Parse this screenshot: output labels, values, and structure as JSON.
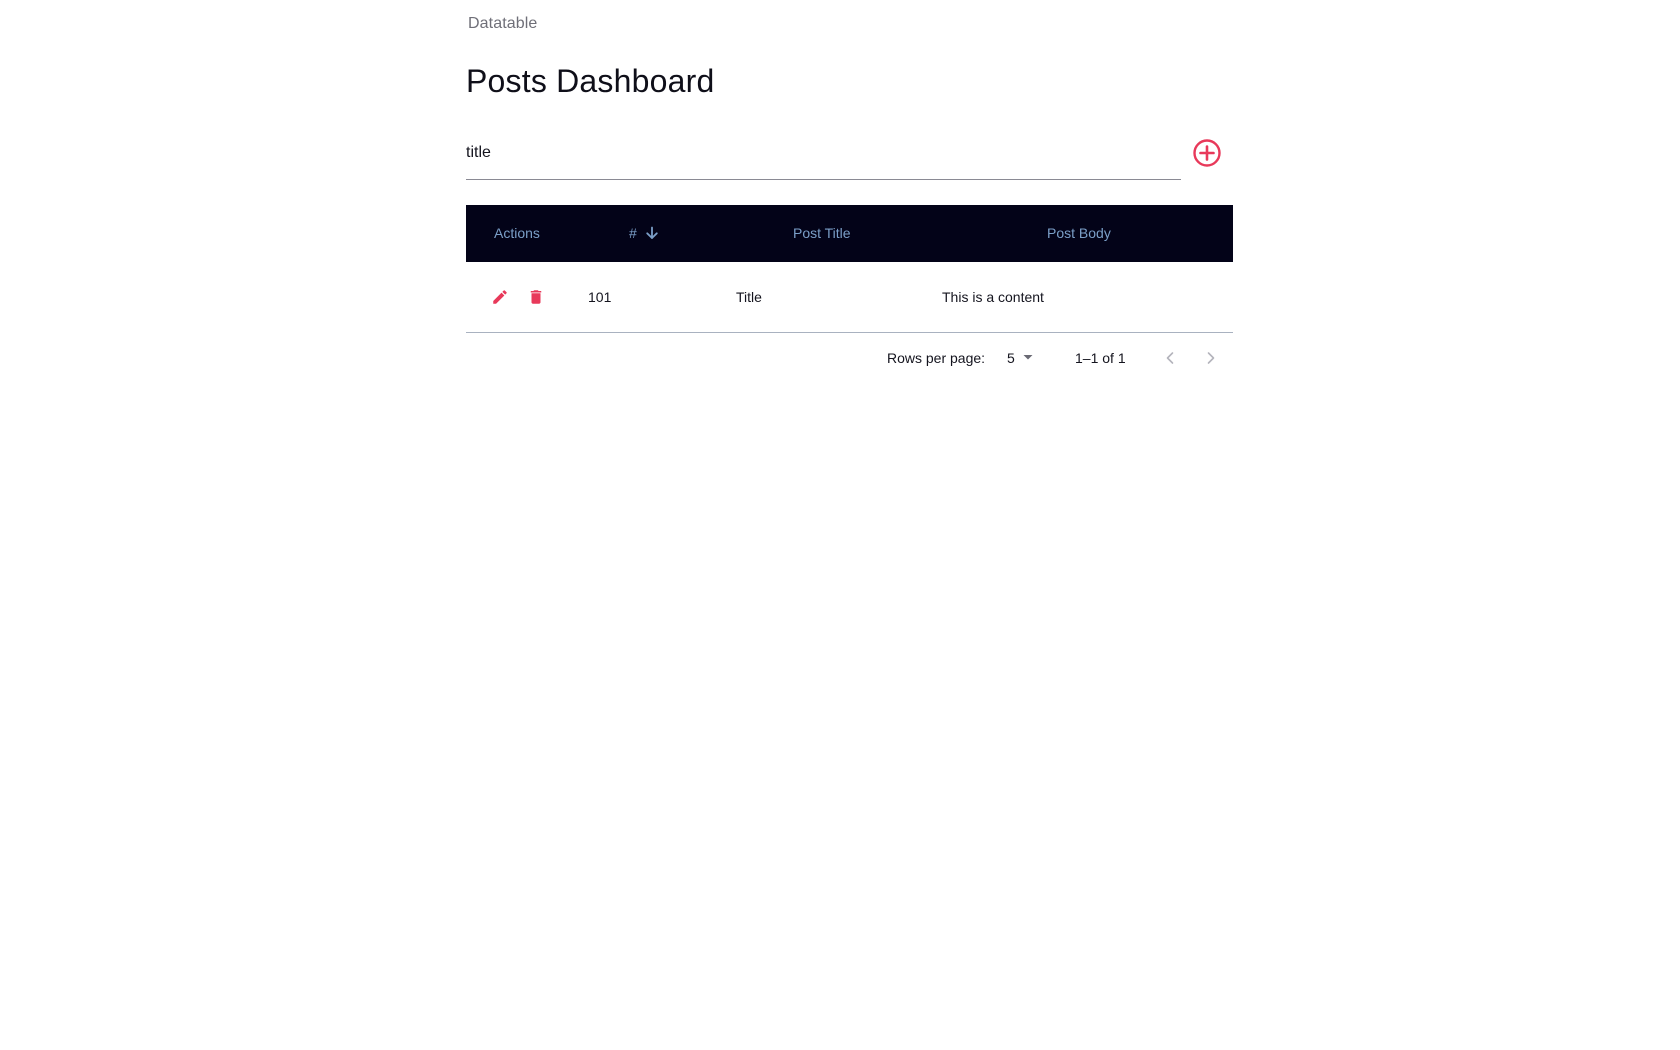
{
  "app": {
    "title": "Datatable"
  },
  "page": {
    "title": "Posts Dashboard"
  },
  "search": {
    "value": "title",
    "placeholder": ""
  },
  "table": {
    "columns": [
      {
        "label": "Actions"
      },
      {
        "label": "#",
        "sort": "descending",
        "sort_icon": "arrow-down-icon"
      },
      {
        "label": "Post Title"
      },
      {
        "label": "Post Body"
      }
    ],
    "rows": [
      {
        "id": "101",
        "title": "Title",
        "body": "This is a content",
        "actions": [
          "edit-icon",
          "delete-icon"
        ]
      }
    ]
  },
  "pagination": {
    "rows_per_page_label": "Rows per page:",
    "rows_per_page": "5",
    "range": "1–1 of 1",
    "prev_icon": "chevron-left-icon",
    "next_icon": "chevron-right-icon"
  },
  "colors": {
    "accent": "#e8395a",
    "header_bg": "#030318",
    "header_text": "#7b9fc8"
  }
}
